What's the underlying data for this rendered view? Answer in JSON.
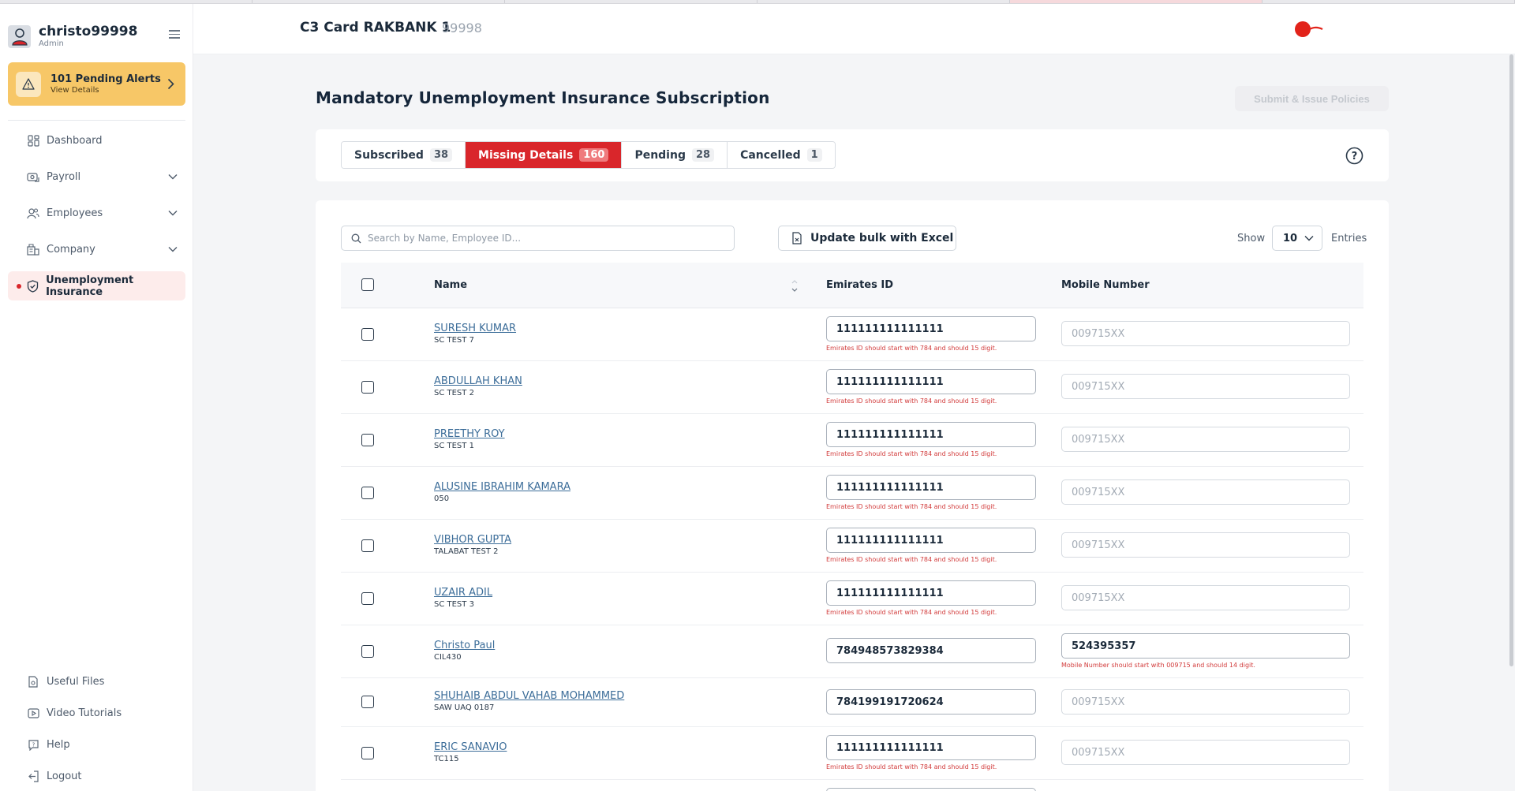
{
  "user": {
    "name": "christo99998",
    "role": "Admin"
  },
  "alert": {
    "title": "101 Pending Alerts",
    "subtitle": "View Details"
  },
  "nav": [
    {
      "label": "Dashboard",
      "icon": "dashboard-icon"
    },
    {
      "label": "Payroll",
      "icon": "payroll-icon"
    },
    {
      "label": "Employees",
      "icon": "employees-icon"
    },
    {
      "label": "Company",
      "icon": "company-icon"
    },
    {
      "label": "Unemployment Insurance",
      "icon": "shield-check-icon",
      "active": true
    }
  ],
  "nav_bottom": [
    {
      "label": "Useful Files",
      "icon": "file-icon"
    },
    {
      "label": "Video Tutorials",
      "icon": "video-icon"
    },
    {
      "label": "Help",
      "icon": "help-chat-icon"
    },
    {
      "label": "Logout",
      "icon": "logout-icon"
    }
  ],
  "header": {
    "company": "C3 Card RAKBANK 1",
    "code": "99998"
  },
  "page": {
    "title": "Mandatory Unemployment Insurance Subscription",
    "submit_label": "Submit & Issue Policies"
  },
  "tabs": [
    {
      "label": "Subscribed",
      "count": "38"
    },
    {
      "label": "Missing Details",
      "count": "160",
      "active": true
    },
    {
      "label": "Pending",
      "count": "28"
    },
    {
      "label": "Cancelled",
      "count": "1"
    }
  ],
  "toolbar": {
    "search_placeholder": "Search by Name, Employee ID...",
    "bulk_label": "Update bulk with Excel",
    "show_label": "Show",
    "entries_value": "10",
    "entries_label": "Entries"
  },
  "table": {
    "columns": {
      "name": "Name",
      "eid": "Emirates ID",
      "mobile": "Mobile Number"
    },
    "mobile_placeholder": "009715XX",
    "rows": [
      {
        "name": "SURESH KUMAR",
        "code": "SC TEST 7",
        "eid": "111111111111111",
        "mobile": "",
        "eid_error": "Emirates ID should start with 784 and should 15 digit.",
        "mobile_error": ""
      },
      {
        "name": "ABDULLAH KHAN",
        "code": "SC TEST 2",
        "eid": "111111111111111",
        "mobile": "",
        "eid_error": "Emirates ID should start with 784 and should 15 digit.",
        "mobile_error": ""
      },
      {
        "name": "PREETHY ROY",
        "code": "SC TEST 1",
        "eid": "111111111111111",
        "mobile": "",
        "eid_error": "Emirates ID should start with 784 and should 15 digit.",
        "mobile_error": ""
      },
      {
        "name": "ALUSINE IBRAHIM KAMARA",
        "code": "050",
        "eid": "111111111111111",
        "mobile": "",
        "eid_error": "Emirates ID should start with 784 and should 15 digit.",
        "mobile_error": ""
      },
      {
        "name": "VIBHOR GUPTA",
        "code": "TALABAT TEST 2",
        "eid": "111111111111111",
        "mobile": "",
        "eid_error": "Emirates ID should start with 784 and should 15 digit.",
        "mobile_error": ""
      },
      {
        "name": "UZAIR ADIL",
        "code": "SC TEST 3",
        "eid": "111111111111111",
        "mobile": "",
        "eid_error": "Emirates ID should start with 784 and should 15 digit.",
        "mobile_error": ""
      },
      {
        "name": "Christo Paul",
        "code": "CIL430",
        "eid": "784948573829384",
        "mobile": "524395357",
        "eid_error": "",
        "mobile_error": "Mobile Number should start with 009715 and should 14 digit."
      },
      {
        "name": "SHUHAIB ABDUL VAHAB MOHAMMED",
        "code": "SAW UAQ 0187",
        "eid": "784199191720624",
        "mobile": "",
        "eid_error": "",
        "mobile_error": ""
      },
      {
        "name": "ERIC SANAVIO",
        "code": "TC115",
        "eid": "111111111111111",
        "mobile": "",
        "eid_error": "Emirates ID should start with 784 and should 15 digit.",
        "mobile_error": ""
      }
    ]
  },
  "colors": {
    "accent": "#d9262b",
    "alert": "#f7c767",
    "link": "#3c6d99",
    "error": "#d23b3b"
  }
}
